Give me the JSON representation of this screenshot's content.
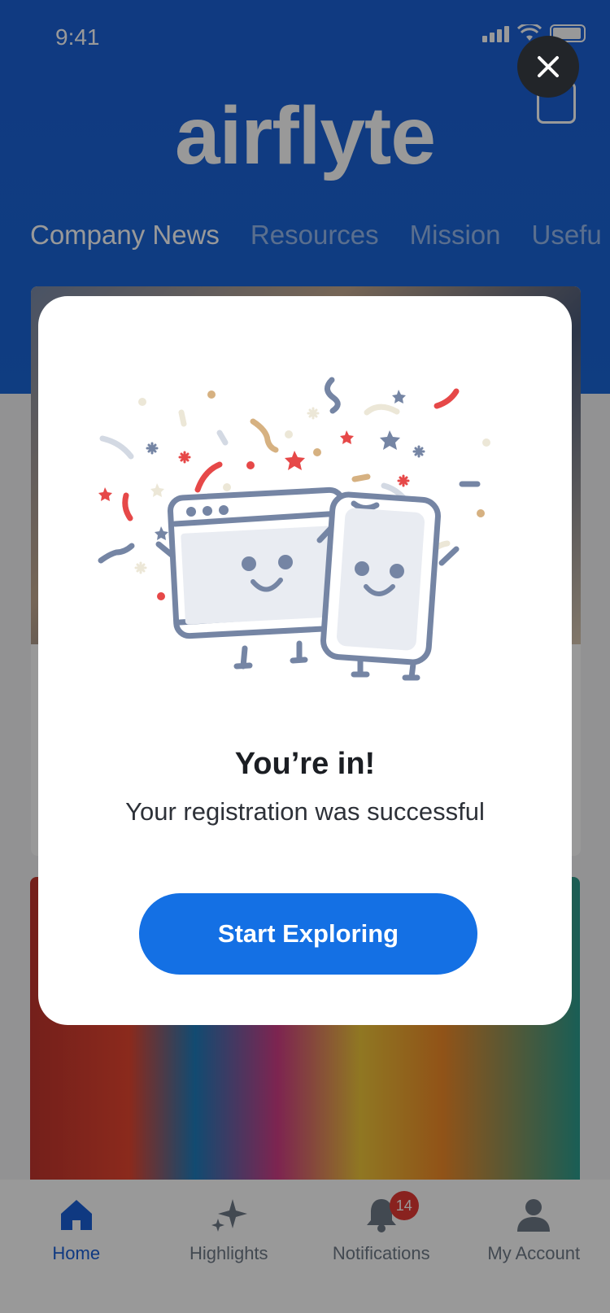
{
  "status_bar": {
    "time": "9:41"
  },
  "header": {
    "brand": "airflyte",
    "tabs": [
      {
        "label": "Company News",
        "active": true
      },
      {
        "label": "Resources",
        "active": false
      },
      {
        "label": "Mission",
        "active": false
      },
      {
        "label": "Usefu",
        "active": false
      }
    ]
  },
  "bottom_nav": {
    "items": [
      {
        "label": "Home",
        "icon": "home-icon",
        "active": true
      },
      {
        "label": "Highlights",
        "icon": "sparkle-icon",
        "active": false
      },
      {
        "label": "Notifications",
        "icon": "bell-icon",
        "active": false,
        "badge": "14"
      },
      {
        "label": "My Account",
        "icon": "user-icon",
        "active": false
      }
    ]
  },
  "modal": {
    "title": "You’re in!",
    "subtitle": "Your registration was successful",
    "cta_label": "Start Exploring",
    "close_icon": "close-icon",
    "illustration": "celebration-devices-illustration"
  },
  "colors": {
    "brand_blue": "#1c61d8",
    "cta_blue": "#1470e4",
    "badge_red": "#e53935",
    "close_bg": "#222529"
  }
}
